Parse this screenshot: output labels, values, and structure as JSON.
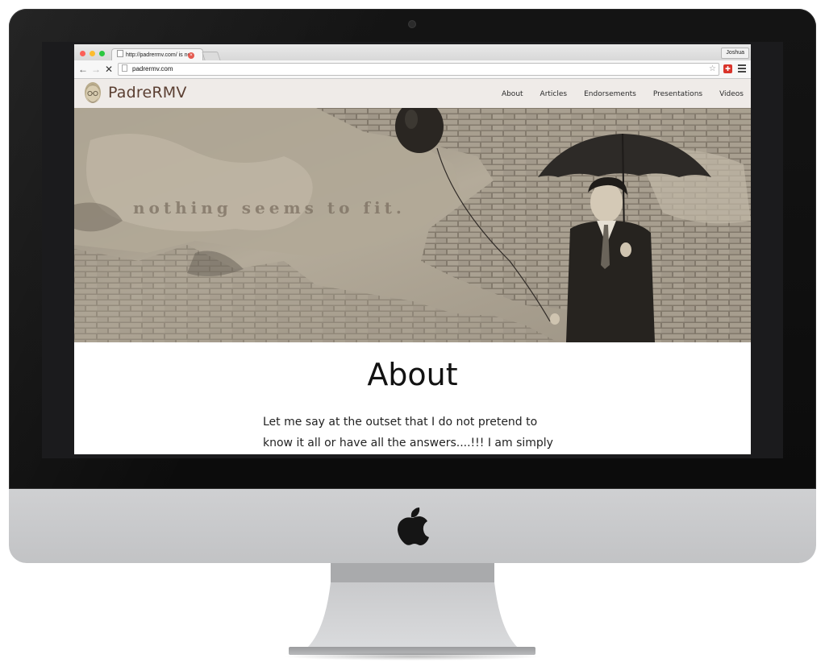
{
  "browser": {
    "tab_title": "http://padrermv.com/ is no",
    "profile_name": "Joshua",
    "url": "padrermv.com"
  },
  "site": {
    "name": "PadreRMV",
    "nav": [
      "About",
      "Articles",
      "Endorsements",
      "Presentations",
      "Videos"
    ],
    "hero_caption": "nothing seems to fit.",
    "page_title": "About",
    "intro_text": "Let me say at the outset that I do not pretend to know it all or have all the answers....!!! I am simply a seeker and a"
  },
  "icons": {
    "back": "back-arrow-icon",
    "forward": "forward-arrow-icon",
    "stop": "stop-icon",
    "star": "star-icon",
    "extension": "extension-icon",
    "menu": "hamburger-menu-icon",
    "brand": "apple-logo-icon"
  },
  "colors": {
    "site_header_bg": "#efebe8",
    "site_name": "#5b3f32",
    "hero_tone": "#b8b0a0"
  }
}
